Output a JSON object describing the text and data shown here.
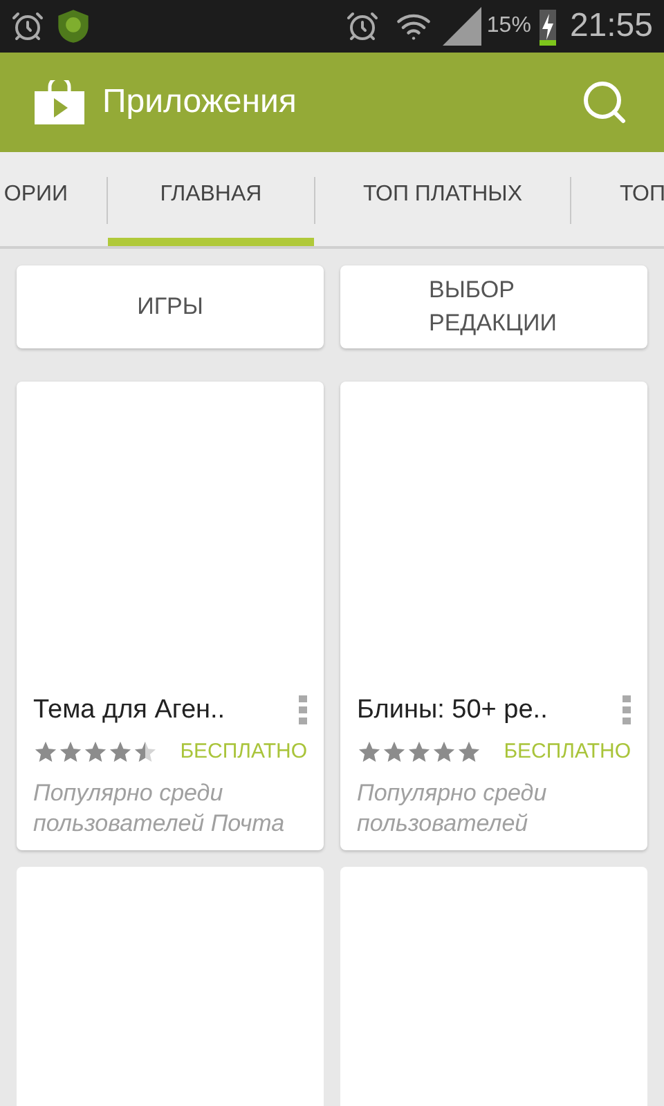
{
  "status_bar": {
    "battery": "15%",
    "time": "21:55"
  },
  "action_bar": {
    "title": "Приложения"
  },
  "tabs": [
    {
      "label": "ОРИИ",
      "selected": false
    },
    {
      "label": "ГЛАВНАЯ",
      "selected": true
    },
    {
      "label": "ТОП ПЛАТНЫХ",
      "selected": false
    },
    {
      "label": "ТОП",
      "selected": false
    }
  ],
  "category_buttons": [
    "ИГРЫ",
    "ВЫБОР РЕДАКЦИИ"
  ],
  "apps": [
    {
      "kind": "listing",
      "name": "Тема для Аген..",
      "stars": 4.5,
      "price": "БЕСПЛАТНО",
      "note": "Популярно среди пользователей Почта"
    },
    {
      "kind": "listing",
      "name": "Блины: 50+ ре..",
      "stars": 5,
      "price": "БЕСПЛАТНО",
      "note": "Популярно среди пользователей"
    },
    {
      "kind": "blank"
    },
    {
      "kind": "blank"
    }
  ]
}
